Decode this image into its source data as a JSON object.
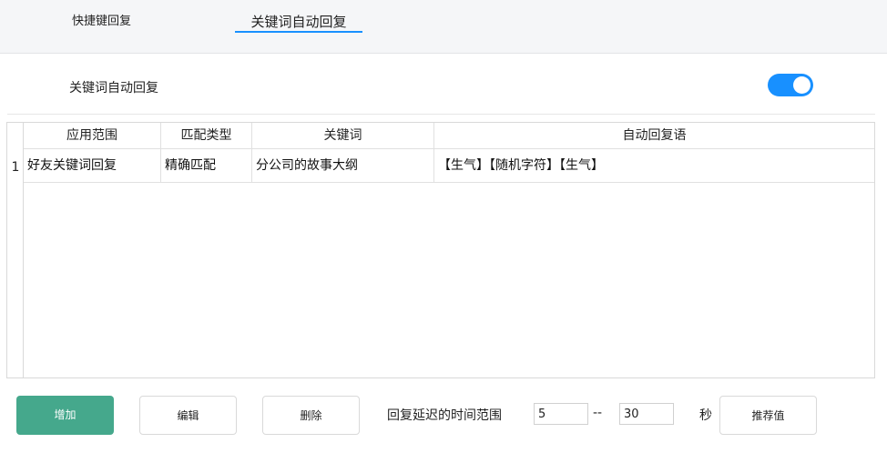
{
  "tabs": [
    {
      "label": "快捷键回复",
      "active": false
    },
    {
      "label": "关键词自动回复",
      "active": true
    }
  ],
  "colors": {
    "accent": "#1890ff",
    "primary_button": "#45a88c"
  },
  "setting": {
    "label": "关键词自动回复",
    "enabled": true
  },
  "table": {
    "columns": [
      "应用范围",
      "匹配类型",
      "关键词",
      "自动回复语"
    ],
    "rows": [
      {
        "index": "1",
        "cells": [
          "好友关键词回复",
          "精确匹配",
          "分公司的故事大纲",
          "【生气】【随机字符】【生气】"
        ]
      }
    ]
  },
  "buttons": {
    "add": "增加",
    "edit": "编辑",
    "delete": "删除",
    "recommend": "推荐值"
  },
  "delay": {
    "label": "回复延迟的时间范围",
    "min": "5",
    "separator": "--",
    "max": "30",
    "unit": "秒"
  }
}
